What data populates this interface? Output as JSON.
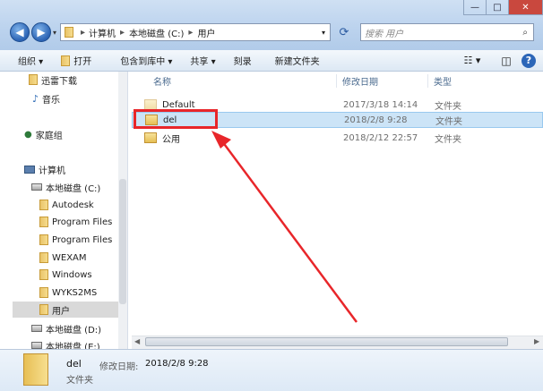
{
  "window": {
    "minimize": "—",
    "maximize": "□",
    "close": "✕"
  },
  "address": {
    "segments": [
      "计算机",
      "本地磁盘 (C:)",
      "用户"
    ],
    "sep": "▸"
  },
  "search": {
    "placeholder": "搜索 用户"
  },
  "toolbar": {
    "organize": "组织 ▾",
    "open": "打开",
    "include": "包含到库中 ▾",
    "share": "共享 ▾",
    "burn": "刻录",
    "new_folder": "新建文件夹"
  },
  "nav": {
    "favorites": [
      {
        "label": "迅雷下载"
      },
      {
        "label": "音乐"
      }
    ],
    "homegroup": "家庭组",
    "computer": "计算机",
    "c_drive": "本地磁盘 (C:)",
    "c_children": [
      "Autodesk",
      "Program Files",
      "Program Files",
      "WEXAM",
      "Windows",
      "WYKS2MS",
      "用户"
    ],
    "other_drives": [
      "本地磁盘 (D:)",
      "本地磁盘 (E:)"
    ]
  },
  "columns": {
    "name": "名称",
    "modified": "修改日期",
    "type": "类型"
  },
  "files": [
    {
      "name": "Default",
      "modified": "2017/3/18 14:14",
      "type": "文件夹"
    },
    {
      "name": "del",
      "modified": "2018/2/8 9:28",
      "type": "文件夹"
    },
    {
      "name": "公用",
      "modified": "2018/2/12 22:57",
      "type": "文件夹"
    }
  ],
  "details": {
    "name": "del",
    "modified_label": "修改日期:",
    "modified": "2018/2/8 9:28",
    "type": "文件夹"
  },
  "colors": {
    "annotation": "#e8262a",
    "selection": "#cce4f7"
  }
}
